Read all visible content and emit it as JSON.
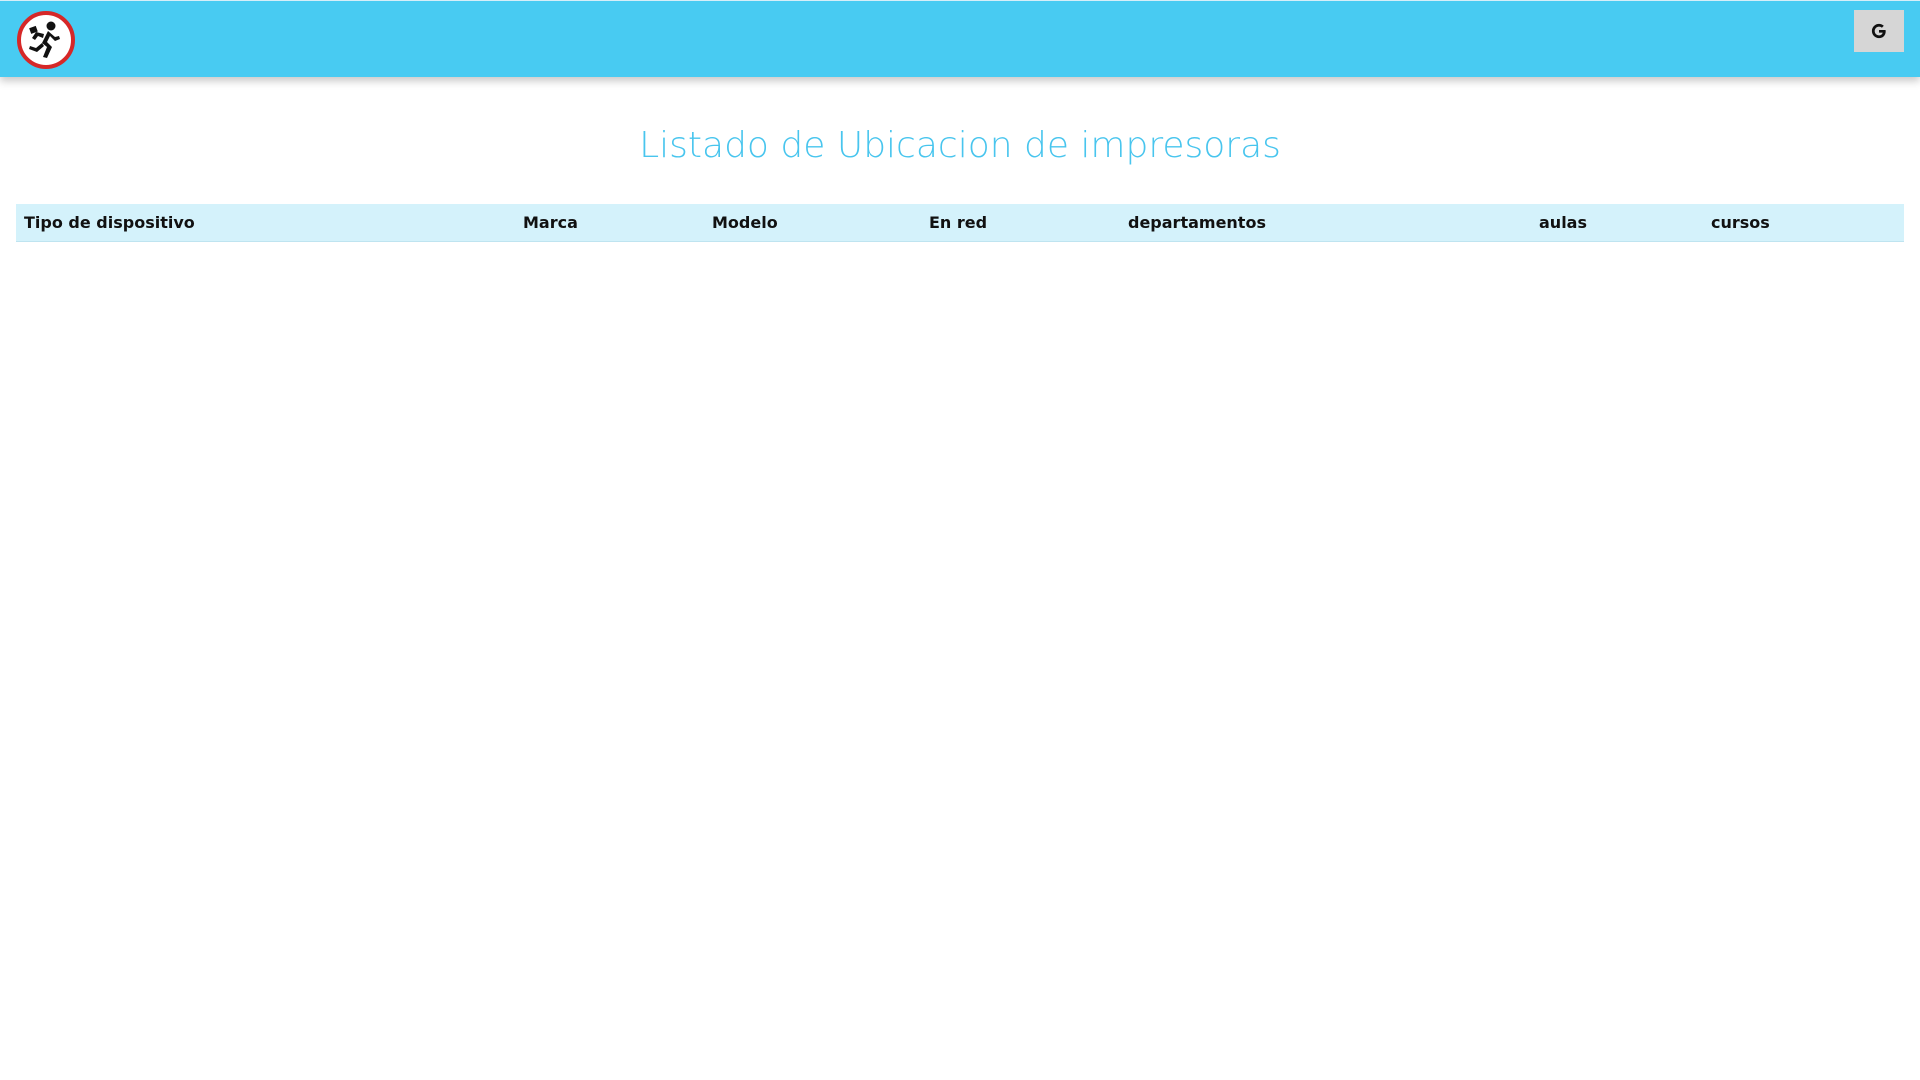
{
  "header": {
    "logo_icon": "running-person-prohibition-logo",
    "google_button_icon": "google-g-icon",
    "accent_color": "#48cbf2"
  },
  "page": {
    "title": "Listado de Ubicacion de impresoras"
  },
  "table": {
    "columns": [
      "Tipo de dispositivo",
      "Marca",
      "Modelo",
      "En red",
      "departamentos",
      "aulas",
      "cursos"
    ],
    "rows": []
  }
}
